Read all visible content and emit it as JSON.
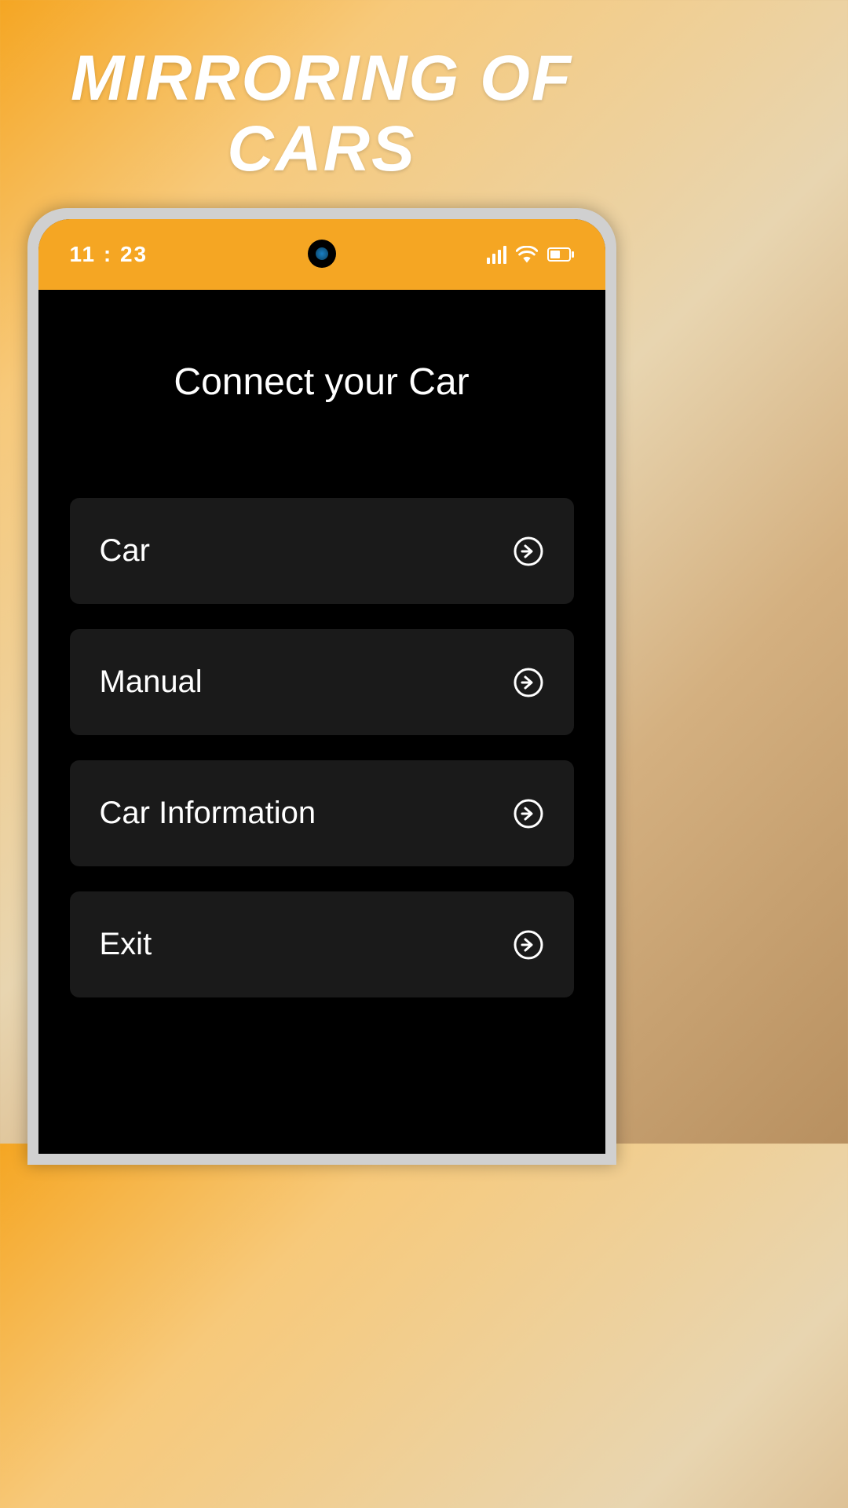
{
  "promo": {
    "title_line1": "MIRRORING OF",
    "title_line2": "CARS"
  },
  "status_bar": {
    "time": "11 : 23"
  },
  "screen": {
    "title": "Connect your Car"
  },
  "menu": {
    "items": [
      {
        "label": "Car"
      },
      {
        "label": "Manual"
      },
      {
        "label": "Car Information"
      },
      {
        "label": "Exit"
      }
    ]
  }
}
